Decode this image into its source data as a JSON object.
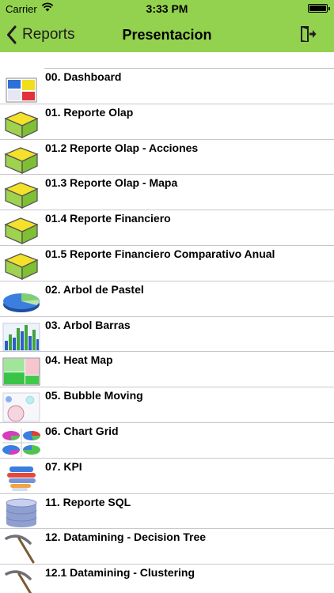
{
  "status_bar": {
    "carrier": "Carrier",
    "time": "3:33 PM",
    "wifi_icon": "wifi-icon",
    "battery_icon": "battery-icon"
  },
  "navbar": {
    "back_label": "Reports",
    "title": "Presentacion",
    "exit_icon": "exit-icon",
    "background": "#93d24f"
  },
  "reports": [
    {
      "label": "00. Dashboard",
      "icon": "dashboard-icon"
    },
    {
      "label": "01. Reporte Olap",
      "icon": "olap-cube-icon"
    },
    {
      "label": "01.2 Reporte Olap - Acciones",
      "icon": "olap-cube-icon"
    },
    {
      "label": "01.3 Reporte Olap - Mapa",
      "icon": "olap-cube-icon"
    },
    {
      "label": "01.4 Reporte Financiero",
      "icon": "olap-cube-icon"
    },
    {
      "label": "01.5 Reporte Financiero Comparativo Anual",
      "icon": "olap-cube-icon"
    },
    {
      "label": "02. Arbol de Pastel",
      "icon": "pie-chart-icon"
    },
    {
      "label": "03. Arbol Barras",
      "icon": "bar-chart-icon"
    },
    {
      "label": "04. Heat Map",
      "icon": "heat-map-icon"
    },
    {
      "label": "05. Bubble Moving",
      "icon": "bubble-chart-icon"
    },
    {
      "label": "06. Chart Grid",
      "icon": "chart-grid-icon"
    },
    {
      "label": "07. KPI",
      "icon": "kpi-icon"
    },
    {
      "label": "11. Reporte SQL",
      "icon": "database-icon"
    },
    {
      "label": "12. Datamining - Decision Tree",
      "icon": "pickaxe-icon"
    },
    {
      "label": "12.1 Datamining - Clustering",
      "icon": "pickaxe-icon"
    }
  ]
}
